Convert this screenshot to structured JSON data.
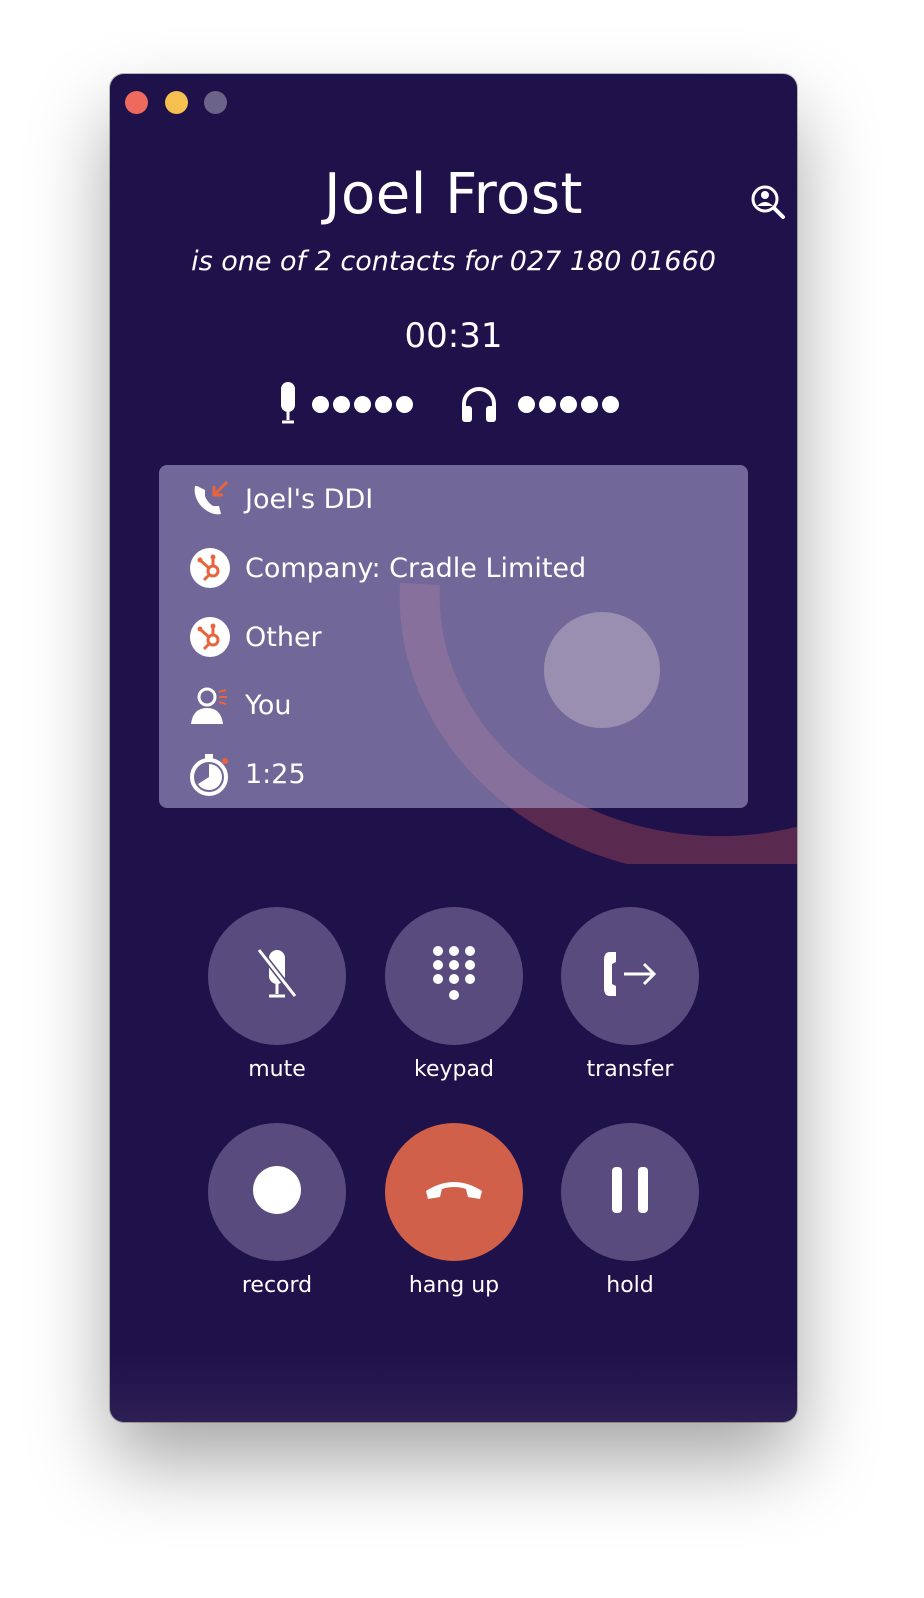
{
  "window": {
    "controls": [
      "close",
      "minimize",
      "maximize"
    ]
  },
  "header": {
    "contact_name": "Joel Frost",
    "subtitle": "is one of 2 contacts for 027 180 01660",
    "search_icon": "contact-search-icon"
  },
  "call": {
    "duration": "00:31",
    "mic_level_icon": "microphone-icon",
    "speaker_level_icon": "headphones-icon"
  },
  "info": {
    "items": [
      {
        "icon": "incoming-call-icon",
        "label": "Joel's DDI"
      },
      {
        "icon": "hubspot-icon",
        "label": "Company: Cradle Limited"
      },
      {
        "icon": "hubspot-icon",
        "label": "Other"
      },
      {
        "icon": "user-icon",
        "label": "You"
      },
      {
        "icon": "stopwatch-icon",
        "label": "1:25"
      }
    ]
  },
  "controls": {
    "mute": "mute",
    "keypad": "keypad",
    "transfer": "transfer",
    "record": "record",
    "hangup": "hang up",
    "hold": "hold"
  },
  "colors": {
    "background": "#1f114a",
    "button": "#5a4b7e",
    "hangup": "#d1604a",
    "accent": "#e8643c"
  }
}
